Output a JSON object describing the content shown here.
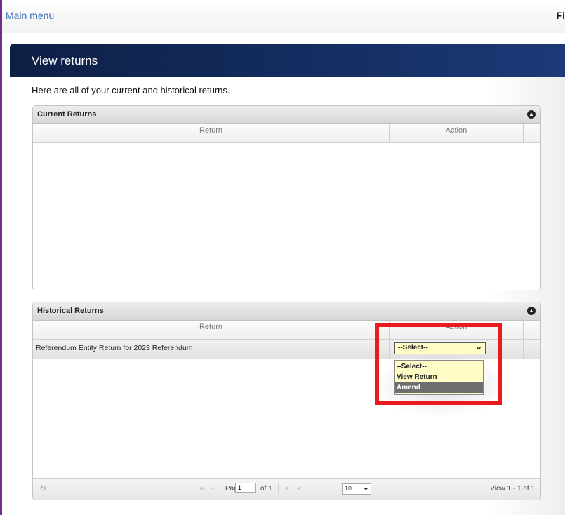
{
  "topbar": {
    "main_menu_label": "Main menu",
    "right_label": "Fi"
  },
  "page": {
    "title": "View returns",
    "intro": "Here are all of your current and historical returns."
  },
  "current_returns": {
    "caption": "Current Returns",
    "columns": [
      "Return",
      "Action"
    ],
    "rows": []
  },
  "historical_returns": {
    "caption": "Historical Returns",
    "columns": [
      "Return",
      "Action"
    ],
    "rows": [
      {
        "return": "Referendum Entity Return for 2023 Referendum",
        "action_selected": "--Select--"
      }
    ],
    "action_options": [
      "--Select--",
      "View Return",
      "Amend"
    ],
    "highlighted_option": "Amend"
  },
  "pager": {
    "page_label": "Page",
    "page_value": "1",
    "of_label": "of 1",
    "rows_per_page": "10",
    "view_count": "View 1 - 1 of 1"
  },
  "colors": {
    "header_bg": "#0d1f45",
    "highlight_border": "#e81c1c",
    "select_bg": "#fffcc5",
    "link": "#3b6fb6"
  }
}
